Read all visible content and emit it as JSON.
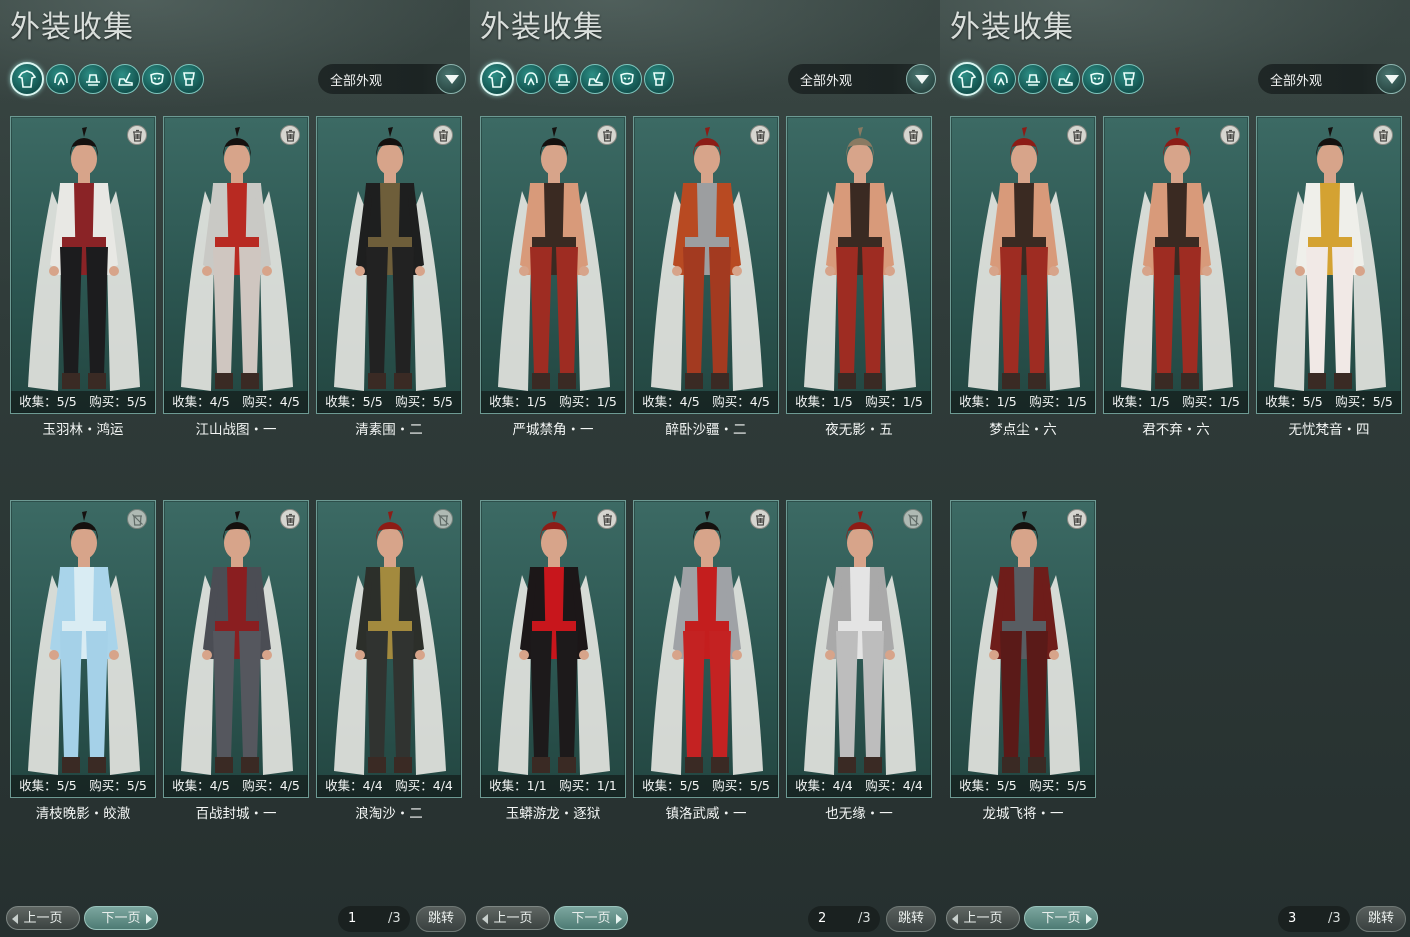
{
  "colors": {
    "card_bg": "#2c5651",
    "card_border": "#6d9a93",
    "accent": "#2d8f86",
    "text": "#f2f4f3"
  },
  "category_icons": [
    "costume-icon",
    "hairstyle-icon",
    "hat-icon",
    "shoes-icon",
    "mask-icon",
    "accessory-icon"
  ],
  "panels": [
    {
      "title": "外装收集",
      "filter": "全部外观",
      "prev_label": "上一页",
      "next_label": "下一页",
      "page_current": "1",
      "page_total": "/3",
      "jump_label": "跳转",
      "cards": [
        {
          "stats": "收集：5/5　购买：5/5",
          "name": "玉羽林・鸿运",
          "trash": "enabled",
          "outfit": {
            "coat": "#e8e8e4",
            "inner": "#8a2326",
            "pants": "#1c1c1e",
            "hair": "#15110f"
          }
        },
        {
          "stats": "收集：4/5　购买：4/5",
          "name": "江山战图・一",
          "trash": "enabled",
          "outfit": {
            "coat": "#c9c9c5",
            "inner": "#b82a22",
            "pants": "#cfc6c0",
            "hair": "#15110f"
          }
        },
        {
          "stats": "收集：5/5　购买：5/5",
          "name": "清素围・二",
          "trash": "enabled",
          "outfit": {
            "coat": "#1e1f1f",
            "inner": "#6e5e3a",
            "pants": "#222222",
            "hair": "#15110f"
          }
        },
        {
          "stats": "收集：5/5　购买：5/5",
          "name": "清枝晚影・皎澈",
          "trash": "disabled",
          "outfit": {
            "coat": "#a9d4ea",
            "inner": "#d9ecf3",
            "pants": "#a5d1e8",
            "hair": "#15110f"
          }
        },
        {
          "stats": "收集：4/5　购买：4/5",
          "name": "百战封城・一",
          "trash": "enabled",
          "outfit": {
            "coat": "#4b4d54",
            "inner": "#8a1e20",
            "pants": "#55575e",
            "hair": "#15110f"
          }
        },
        {
          "stats": "收集：4/4　购买：4/4",
          "name": "浪淘沙・二",
          "trash": "disabled",
          "outfit": {
            "coat": "#2c2f2a",
            "inner": "#a38a3e",
            "pants": "#303330",
            "hair": "#8d1c16"
          }
        }
      ]
    },
    {
      "title": "外装收集",
      "filter": "全部外观",
      "prev_label": "上一页",
      "next_label": "下一页",
      "page_current": "2",
      "page_total": "/3",
      "jump_label": "跳转",
      "cards": [
        {
          "stats": "收集：1/5　购买：1/5",
          "name": "严城禁角・一",
          "trash": "enabled",
          "outfit": {
            "coat": "#d89a7a",
            "inner": "#3a2a22",
            "pants": "#9e2c22",
            "hair": "#15110f"
          }
        },
        {
          "stats": "收集：4/5　购买：4/5",
          "name": "醉卧沙疆・二",
          "trash": "enabled",
          "outfit": {
            "coat": "#b84a22",
            "inner": "#9c9ea0",
            "pants": "#a33a20",
            "hair": "#8d1c16"
          }
        },
        {
          "stats": "收集：1/5　购买：1/5",
          "name": "夜无影・五",
          "trash": "enabled",
          "outfit": {
            "coat": "#d89a7a",
            "inner": "#3a2a22",
            "pants": "#9e2c22",
            "hair": "#8a7a62"
          }
        },
        {
          "stats": "收集：1/1　购买：1/1",
          "name": "玉蟒游龙・逐狱",
          "trash": "enabled",
          "outfit": {
            "coat": "#1c1718",
            "inner": "#c8161c",
            "pants": "#1d1a1b",
            "hair": "#8d1c16"
          }
        },
        {
          "stats": "收集：5/5　购买：5/5",
          "name": "镇洛武威・一",
          "trash": "enabled",
          "outfit": {
            "coat": "#9fa2a6",
            "inner": "#c41e1e",
            "pants": "#c42222",
            "hair": "#15110f"
          }
        },
        {
          "stats": "收集：4/4　购买：4/4",
          "name": "也无缘・一",
          "trash": "disabled",
          "outfit": {
            "coat": "#a9a9a9",
            "inner": "#e4e4e4",
            "pants": "#bdbdbd",
            "hair": "#8d1c16"
          }
        }
      ]
    },
    {
      "title": "外装收集",
      "filter": "全部外观",
      "prev_label": "上一页",
      "next_label": "下一页",
      "page_current": "3",
      "page_total": "/3",
      "jump_label": "跳转",
      "cards": [
        {
          "stats": "收集：1/5　购买：1/5",
          "name": "梦点尘・六",
          "trash": "enabled",
          "outfit": {
            "coat": "#d89a7a",
            "inner": "#3a2a22",
            "pants": "#9e2c22",
            "hair": "#8d1c16"
          }
        },
        {
          "stats": "收集：1/5　购买：1/5",
          "name": "君不弃・六",
          "trash": "enabled",
          "outfit": {
            "coat": "#d89a7a",
            "inner": "#3a2a22",
            "pants": "#9e2c22",
            "hair": "#8d1c16"
          }
        },
        {
          "stats": "收集：5/5　购买：5/5",
          "name": "无忧梵音・四",
          "trash": "enabled",
          "outfit": {
            "coat": "#efefea",
            "inner": "#d4a232",
            "pants": "#f1e9e6",
            "hair": "#15110f"
          }
        },
        {
          "stats": "收集：5/5　购买：5/5",
          "name": "龙城飞将・一",
          "trash": "enabled",
          "outfit": {
            "coat": "#6e1d1a",
            "inner": "#585d62",
            "pants": "#5a1a18",
            "hair": "#15110f"
          }
        }
      ]
    }
  ]
}
